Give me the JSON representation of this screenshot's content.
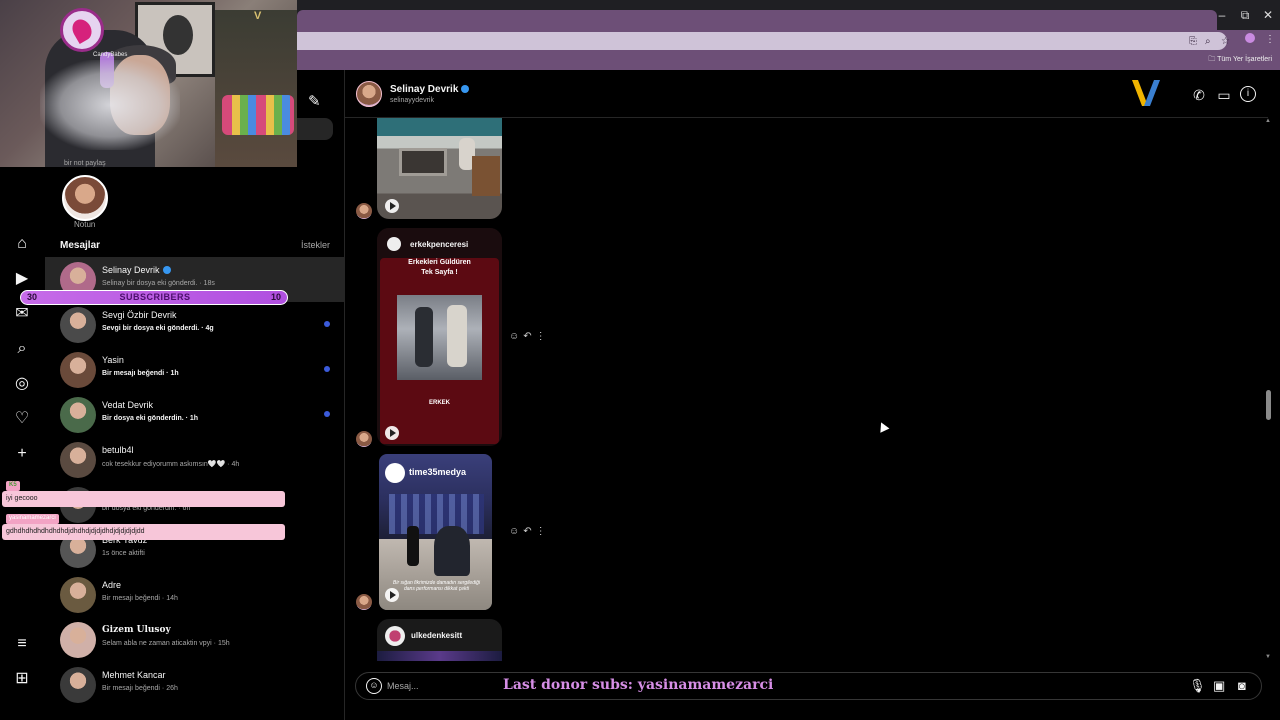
{
  "browser": {
    "window_controls": [
      "–",
      "⧉",
      "✕"
    ],
    "bookmarks_label": "Tüm Yer İşaretleri"
  },
  "stream_overlay": {
    "webcam_caption": "CandyBabes",
    "subbar": {
      "left": "30",
      "label": "SUBSCRIBERS",
      "right": "10"
    },
    "chat": [
      {
        "tag": "K5",
        "message": "iyi gecooo"
      },
      {
        "tag": "yasinamamezarci",
        "message": "gdhdhdhdhdhdhdhdjdhdhdjdjdjdhdjdjdjdjdjdd"
      }
    ],
    "donor_text": "Last donor subs: yasinamamezarci"
  },
  "sidebar": {
    "note_caption": "bir not paylaş",
    "note_label": "Notun",
    "heading": "Mesajlar",
    "requests": "İstekler",
    "conversations": [
      {
        "name": "Selinay Devrik",
        "verified": true,
        "preview": "Selinay bir dosya eki gönderdi. · 18s",
        "unread": false,
        "color": "#b06a8a"
      },
      {
        "name": "Sevgi Özbir Devrik",
        "verified": false,
        "preview": "Sevgi bir dosya eki gönderdi. · 4g",
        "unread": true,
        "color": "#4a4a4a"
      },
      {
        "name": "Yasin",
        "verified": false,
        "preview": "Bir mesajı beğendi · 1h",
        "unread": true,
        "color": "#6a4a3a"
      },
      {
        "name": "Vedat Devrik",
        "verified": false,
        "preview": "Bir dosya eki gönderdin. · 1h",
        "unread": true,
        "color": "#4a6a4a"
      },
      {
        "name": "betulb4l",
        "verified": false,
        "preview": "cok tesekkur ediyorumm askımsın🤍🤍 · 4h",
        "unread": false,
        "color": "#5a4a40"
      },
      {
        "name": "",
        "verified": false,
        "preview": "bir dosya eki gönderdin. · 6h",
        "unread": false,
        "color": "#3a3a3a"
      },
      {
        "name": "Berk Yavuz",
        "verified": false,
        "preview": "1s önce aktifti",
        "unread": false,
        "color": "#555"
      },
      {
        "name": "Adre",
        "verified": false,
        "preview": "Bir mesajı beğendi · 14h",
        "unread": false,
        "color": "#6a5a40"
      },
      {
        "name": "Gizem Ulusoy",
        "verified": false,
        "preview": "Selam abla ne zaman aticaktin vpyi · 15h",
        "unread": false,
        "color": "#d0b0a8"
      },
      {
        "name": "Mehmet Kancar",
        "verified": false,
        "preview": "Bir mesajı beğendi · 26h",
        "unread": false,
        "color": "#3a3a3a"
      }
    ]
  },
  "chat": {
    "name": "Selinay Devrik",
    "username": "selinayydevrik",
    "cards": [
      {
        "account": "erkekpenceresi",
        "headline": "Erkekleri Güldüren\nTek Sayfa !",
        "brand": "ERKEK"
      },
      {
        "account": "time35medya",
        "caption": "Bir sığan fikrimizde damadın sergilediği dans performansı dikkat çekti"
      },
      {
        "account": "ulkedenkesitt"
      }
    ],
    "composer_placeholder": "Mesaj..."
  }
}
